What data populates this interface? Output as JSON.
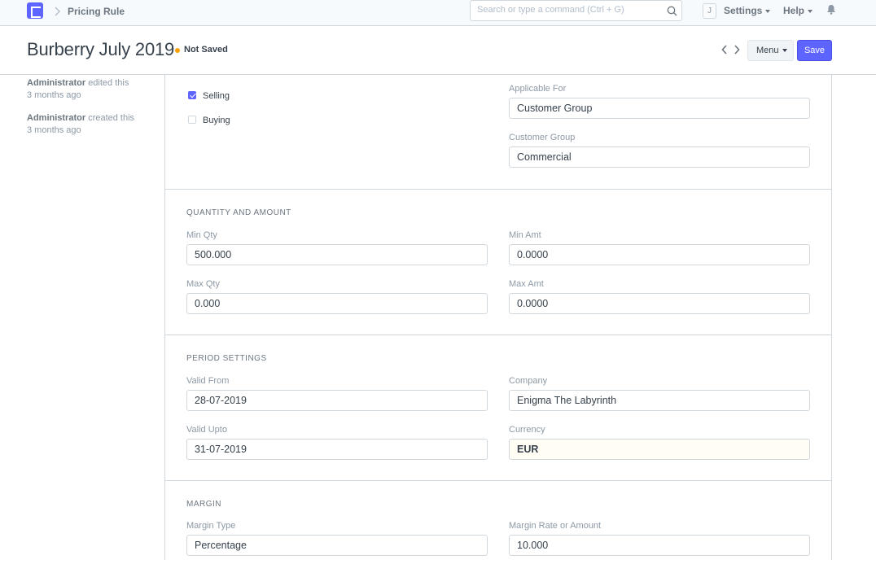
{
  "navbar": {
    "breadcrumb": "Pricing Rule",
    "search_placeholder": "Search or type a command (Ctrl + G)",
    "avatar_initial": "J",
    "settings_label": "Settings",
    "help_label": "Help"
  },
  "page": {
    "title": "Burberry July 2019",
    "status": "Not Saved",
    "menu_label": "Menu",
    "save_label": "Save"
  },
  "timeline": [
    {
      "user": "Administrator",
      "action": "edited this",
      "time": "3 months ago"
    },
    {
      "user": "Administrator",
      "action": "created this",
      "time": "3 months ago"
    }
  ],
  "form": {
    "applicable": {
      "selling_label": "Selling",
      "selling_checked": true,
      "buying_label": "Buying",
      "buying_checked": false,
      "applicable_for_label": "Applicable For",
      "applicable_for_value": "Customer Group",
      "customer_group_label": "Customer Group",
      "customer_group_value": "Commercial"
    },
    "quantity_amount": {
      "heading": "QUANTITY AND AMOUNT",
      "min_qty_label": "Min Qty",
      "min_qty_value": "500.000",
      "min_amt_label": "Min Amt",
      "min_amt_value": "0.0000",
      "max_qty_label": "Max Qty",
      "max_qty_value": "0.000",
      "max_amt_label": "Max Amt",
      "max_amt_value": "0.0000"
    },
    "period": {
      "heading": "PERIOD SETTINGS",
      "valid_from_label": "Valid From",
      "valid_from_value": "28-07-2019",
      "company_label": "Company",
      "company_value": "Enigma The Labyrinth",
      "valid_upto_label": "Valid Upto",
      "valid_upto_value": "31-07-2019",
      "currency_label": "Currency",
      "currency_value": "EUR"
    },
    "margin": {
      "heading": "MARGIN",
      "margin_type_label": "Margin Type",
      "margin_type_value": "Percentage",
      "margin_rate_label": "Margin Rate or Amount",
      "margin_rate_value": "10.000"
    }
  },
  "colors": {
    "primary": "#5e64ff",
    "status_indicator": "#ffa00a",
    "border": "#d1d8dd"
  }
}
